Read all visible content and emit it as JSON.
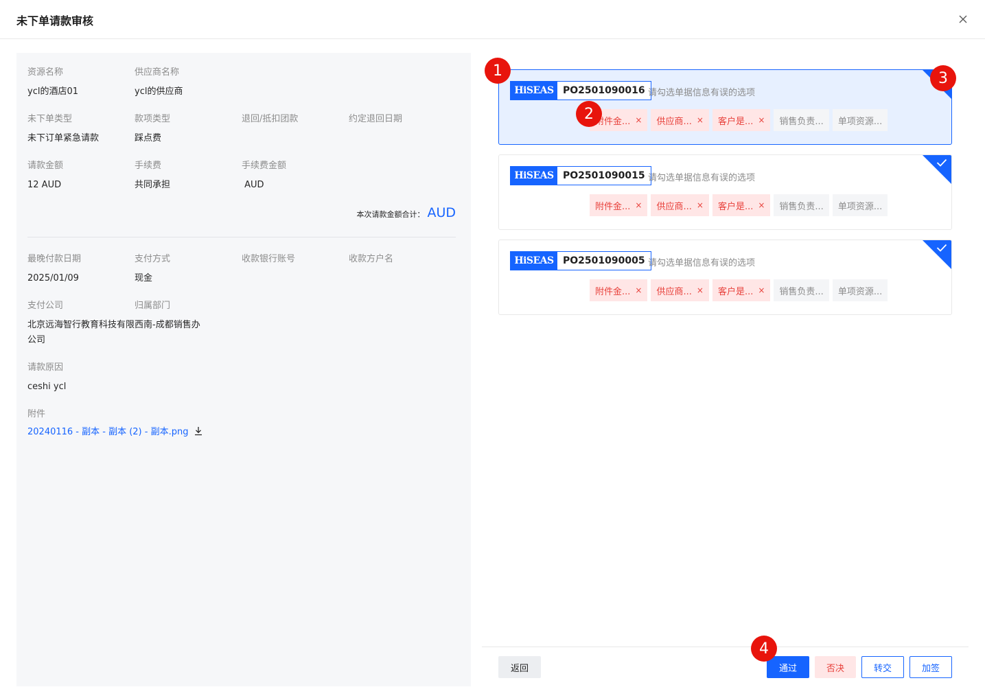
{
  "dialog": {
    "title": "未下单请款审核",
    "close_icon": "close-icon"
  },
  "info": {
    "resource_name": {
      "label": "资源名称",
      "value": "ycl的酒店01"
    },
    "supplier_name": {
      "label": "供应商名称",
      "value": "ycl的供应商"
    },
    "order_type": {
      "label": "未下单类型",
      "value": "未下订单紧急请款"
    },
    "payment_type": {
      "label": "款项类型",
      "value": "踩点费"
    },
    "refund": {
      "label": "退回/抵扣团款",
      "value": ""
    },
    "refund_date": {
      "label": "约定退回日期",
      "value": ""
    },
    "amount": {
      "label": "请款金额",
      "value": "12 AUD"
    },
    "fee": {
      "label": "手续费",
      "value": "共同承担"
    },
    "fee_amount": {
      "label": "手续费金额",
      "value": " AUD"
    },
    "total": {
      "label": "本次请款金额合计：",
      "value": "AUD"
    },
    "latest_date": {
      "label": "最晚付款日期",
      "value": "2025/01/09"
    },
    "pay_method": {
      "label": "支付方式",
      "value": "现金"
    },
    "bank_account": {
      "label": "收款银行账号",
      "value": ""
    },
    "payee": {
      "label": "收款方户名",
      "value": ""
    },
    "pay_company": {
      "label": "支付公司",
      "value": "北京远海智行教育科技有限公司"
    },
    "department": {
      "label": "归属部门",
      "value": "西南-成都销售办"
    },
    "reason": {
      "label": "请款原因",
      "value": "ceshi ycl"
    },
    "attachment": {
      "label": "附件",
      "file": "20240116 - 副本 - 副本 (2) - 副本.png",
      "icon": "download-icon"
    }
  },
  "cards": [
    {
      "logo": "HiSEAS",
      "po": "PO2501090016",
      "hint": "请勾选单据信息有误的选项",
      "active": true,
      "tags": [
        {
          "text": "附件金...",
          "error": true
        },
        {
          "text": "供应商...",
          "error": true
        },
        {
          "text": "客户是...",
          "error": true
        },
        {
          "text": "销售负责...",
          "error": false
        },
        {
          "text": "单项资源...",
          "error": false
        }
      ]
    },
    {
      "logo": "HiSEAS",
      "po": "PO2501090015",
      "hint": "请勾选单据信息有误的选项",
      "active": false,
      "tags": [
        {
          "text": "附件金...",
          "error": true
        },
        {
          "text": "供应商...",
          "error": true
        },
        {
          "text": "客户是...",
          "error": true
        },
        {
          "text": "销售负责...",
          "error": false
        },
        {
          "text": "单项资源...",
          "error": false
        }
      ]
    },
    {
      "logo": "HiSEAS",
      "po": "PO2501090005",
      "hint": "请勾选单据信息有误的选项",
      "active": false,
      "tags": [
        {
          "text": "附件金...",
          "error": true
        },
        {
          "text": "供应商...",
          "error": true
        },
        {
          "text": "客户是...",
          "error": true
        },
        {
          "text": "销售负责...",
          "error": false
        },
        {
          "text": "单项资源...",
          "error": false
        }
      ]
    }
  ],
  "tag_close_glyph": "×",
  "buttons": {
    "back": "返回",
    "pass": "通过",
    "reject": "否决",
    "transfer": "转交",
    "sign": "加签"
  },
  "markers": [
    "1",
    "2",
    "3",
    "4"
  ],
  "colors": {
    "primary": "#1664ff",
    "error": "#e8423c",
    "error_bg": "#ffe6e6",
    "marker": "#e8140c",
    "panel_bg": "#f6f7f9"
  }
}
